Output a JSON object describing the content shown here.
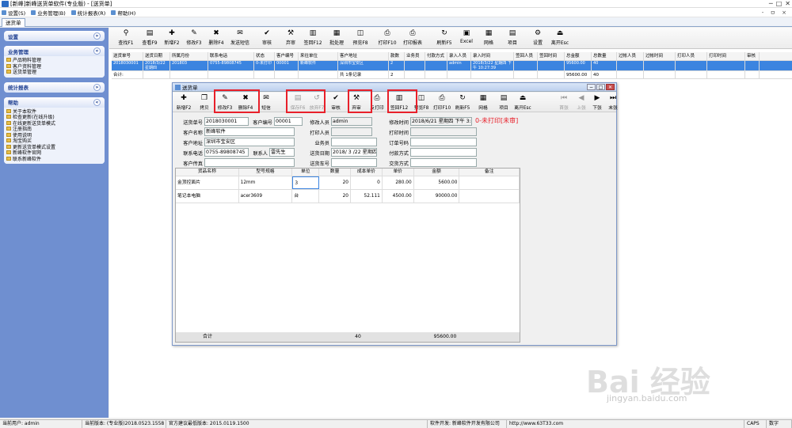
{
  "window": {
    "title": "[新峰]新峰送货单软件(专业版) - [送货单]",
    "controls": [
      "─",
      "□",
      "✕"
    ]
  },
  "menu": [
    {
      "label": "设置(S)"
    },
    {
      "label": "业务管理(B)"
    },
    {
      "label": "统计报表(R)"
    },
    {
      "label": "帮助(H)"
    }
  ],
  "mdi_controls": "- ㅁ ×",
  "tab": "送货单",
  "sidebar": {
    "groups": [
      {
        "title": "设置",
        "chevron": "»",
        "items": []
      },
      {
        "title": "业务管理",
        "chevron": "«",
        "items": [
          "产品物料管理",
          "客户资料管理",
          "送货单管理"
        ]
      },
      {
        "title": "统计报表",
        "chevron": "»",
        "items": []
      },
      {
        "title": "帮助",
        "chevron": "«",
        "items": [
          "关于本软件",
          "检查更新(在线升级)",
          "在线更新送货单模式",
          "注册指南",
          "使用说明",
          "淘宝购买",
          "更新送货单模式设置",
          "新峰软件官网",
          "联系新峰软件"
        ]
      }
    ]
  },
  "main_toolbar": [
    {
      "icon": "binoculars-icon",
      "glyph": "⚲",
      "label": "查找F1"
    },
    {
      "icon": "view-icon",
      "glyph": "▤",
      "label": "查看F9"
    },
    {
      "icon": "new-icon",
      "glyph": "✚",
      "label": "新增F2"
    },
    {
      "icon": "edit-icon",
      "glyph": "✎",
      "label": "修改F3"
    },
    {
      "icon": "delete-icon",
      "glyph": "✖",
      "label": "删除F4"
    },
    {
      "icon": "sms-icon",
      "glyph": "✉",
      "label": "发送短信"
    },
    {
      "icon": "audit-icon",
      "glyph": "✔",
      "label": "审核"
    },
    {
      "icon": "abandon-icon",
      "glyph": "⚒",
      "label": "弃审"
    },
    {
      "icon": "sign-icon",
      "glyph": "▥",
      "label": "签回F12"
    },
    {
      "icon": "batch-icon",
      "glyph": "▦",
      "label": "批处理"
    },
    {
      "icon": "preview-icon",
      "glyph": "◫",
      "label": "预览F8"
    },
    {
      "icon": "print-icon",
      "glyph": "⎙",
      "label": "打印F10"
    },
    {
      "icon": "report-icon",
      "glyph": "⎙",
      "label": "打印报表"
    },
    {
      "icon": "refresh-icon",
      "glyph": "↻",
      "label": "刷新F5"
    },
    {
      "icon": "excel-icon",
      "glyph": "▣",
      "label": "Excel"
    },
    {
      "icon": "grid-icon",
      "glyph": "▦",
      "label": "网格"
    },
    {
      "icon": "item-icon",
      "glyph": "▤",
      "label": "项目"
    },
    {
      "icon": "settings-icon",
      "glyph": "⚙",
      "label": "设置"
    },
    {
      "icon": "exit-icon",
      "glyph": "⏏",
      "label": "离开Esc"
    }
  ],
  "main_grid": {
    "headers": [
      "送货单号",
      "送货日期",
      "所属月份",
      "联系电话",
      "状态",
      "客户编号",
      "来往单位",
      "客户地址",
      "款数",
      "业务员",
      "付款方式",
      "录入人员",
      "录入时间",
      "签回人员",
      "签回时间",
      "总金额",
      "总数量",
      "过帐人员",
      "过帐时间",
      "打印人员",
      "打印时间",
      "审核"
    ],
    "row": [
      "2018030001",
      "2018/3/22 星期四",
      "201803",
      "0755-89808745",
      "0-未打印",
      "00001",
      "新峰软件",
      "深圳市宝安区",
      "2",
      "",
      "",
      "admin",
      "2018/3/22 星期四 下午 10:27:39",
      "",
      "",
      "95600.00",
      "40",
      "",
      "",
      "",
      "",
      ""
    ],
    "sum_label": "合计:",
    "sum_note": "共 1条记录",
    "sum_count": "2",
    "sum_amount": "95600.00",
    "sum_qty": "40"
  },
  "dialog": {
    "title": "送货单",
    "toolbar": [
      {
        "icon": "new-icon",
        "glyph": "✚",
        "label": "新增F2",
        "disabled": false
      },
      {
        "icon": "copy-icon",
        "glyph": "❐",
        "label": "拷贝",
        "disabled": false
      },
      {
        "icon": "edit-icon",
        "glyph": "✎",
        "label": "修改F3",
        "disabled": false
      },
      {
        "icon": "delete-icon",
        "glyph": "✖",
        "label": "删除F4",
        "disabled": false
      },
      {
        "icon": "sms-icon",
        "glyph": "✉",
        "label": "短信",
        "disabled": false
      },
      {
        "icon": "save-icon",
        "glyph": "▤",
        "label": "保存F6",
        "disabled": true
      },
      {
        "icon": "undo-icon",
        "glyph": "↺",
        "label": "放弃F7",
        "disabled": true
      },
      {
        "icon": "audit-icon",
        "glyph": "✔",
        "label": "审核",
        "disabled": false
      },
      {
        "icon": "abandon-icon",
        "glyph": "⚒",
        "label": "弃审",
        "disabled": false
      },
      {
        "icon": "reverse-print-icon",
        "glyph": "⎙",
        "label": "反打印",
        "disabled": false
      },
      {
        "icon": "sign-icon",
        "glyph": "▥",
        "label": "签回F12",
        "disabled": false
      },
      {
        "icon": "preview-icon",
        "glyph": "◫",
        "label": "预览F8",
        "disabled": false
      },
      {
        "icon": "print-icon",
        "glyph": "⎙",
        "label": "打印F10",
        "disabled": false
      },
      {
        "icon": "refresh-icon",
        "glyph": "↻",
        "label": "刷新F5",
        "disabled": false
      },
      {
        "icon": "grid-icon",
        "glyph": "▦",
        "label": "网格",
        "disabled": false
      },
      {
        "icon": "item-icon",
        "glyph": "▤",
        "label": "项目",
        "disabled": false
      },
      {
        "icon": "exit-icon",
        "glyph": "⏏",
        "label": "离开Esc",
        "disabled": false
      },
      {
        "icon": "first-icon",
        "glyph": "⏮",
        "label": "首张",
        "disabled": true
      },
      {
        "icon": "prev-icon",
        "glyph": "◀",
        "label": "上张",
        "disabled": true
      },
      {
        "icon": "next-icon",
        "glyph": "▶",
        "label": "下张",
        "disabled": false
      },
      {
        "icon": "last-icon",
        "glyph": "⏭",
        "label": "末张",
        "disabled": false
      }
    ],
    "form": {
      "order_no_label": "送货单号",
      "order_no": "2018030001",
      "cust_no_label": "客户编号",
      "cust_no": "00001",
      "modifier_label": "修改人员",
      "modifier": "admin",
      "modify_time_label": "修改时间",
      "modify_time": "2018/6/21 星期四 下午 3:49",
      "status": "0-未打印[未审]",
      "cust_name_label": "客户名称",
      "cust_name": "新峰软件",
      "printer_label": "打印人员",
      "printer": "",
      "print_time_label": "打印时间",
      "print_time": "",
      "address_label": "客户地址",
      "address": "深圳市宝安区",
      "salesman_label": "业务员",
      "salesman": "",
      "order_code_label": "订单号码",
      "order_code": "",
      "phone_label": "联系电话",
      "phone": "0755-89808745",
      "contact_label": "联系人",
      "contact": "雷先生",
      "date_label": "送货日期",
      "date": "2018/ 3 /22 星期四",
      "payment_label": "付款方式",
      "payment": "",
      "fax_label": "客户传真",
      "fax": "",
      "vehicle_label": "送货车号",
      "vehicle": "",
      "trade_label": "交货方式",
      "trade": ""
    },
    "grid": {
      "headers": [
        "货品名称",
        "型号规格",
        "单位",
        "数量",
        "成本单价",
        "单价",
        "金额",
        "备注"
      ],
      "rows": [
        [
          "金顶控面片",
          "12mm",
          "3",
          "20",
          "0",
          "280.00",
          "5600.00",
          ""
        ],
        [
          "笔记本电脑",
          "acer3609",
          "台",
          "20",
          "52.111",
          "4500.00",
          "90000.00",
          ""
        ]
      ],
      "footer_label": "合计",
      "footer_qty": "40",
      "footer_amount": "95600.00"
    }
  },
  "statusbar": [
    "当前用户: admin",
    "当前版本: (专业版)2018.0523.1558",
    "官方建议最低版本: 2015.0119.1500",
    "软件开发: 新峰软件开发有限公司",
    "http://www.63T33.com",
    "CAPS",
    "数字"
  ],
  "watermark": "Bai  经验",
  "watermark_url": "jingyan.baidu.com"
}
